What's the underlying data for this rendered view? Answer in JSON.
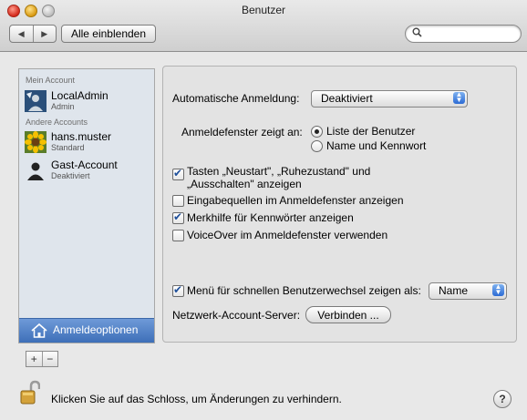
{
  "window": {
    "title": "Benutzer"
  },
  "toolbar": {
    "back": "◀",
    "forward": "▶",
    "show_all": "Alle einblenden",
    "search_icon": "search-icon"
  },
  "sidebar": {
    "my_account_header": "Mein Account",
    "other_accounts_header": "Andere Accounts",
    "accounts": [
      {
        "name": "LocalAdmin",
        "role": "Admin"
      },
      {
        "name": "hans.muster",
        "role": "Standard"
      },
      {
        "name": "Gast-Account",
        "role": "Deaktiviert"
      }
    ],
    "login_options": "Anmeldeoptionen",
    "add": "+",
    "remove": "−"
  },
  "panel": {
    "auto_login_label": "Automatische Anmeldung:",
    "auto_login_value": "Deaktiviert",
    "window_shows_label": "Anmeldefenster zeigt an:",
    "radio_list": "Liste der Benutzer",
    "radio_name": "Name und Kennwort",
    "check_restart_line1": "Tasten „Neustart\", „Ruhezustand\" und",
    "check_restart_line2": "„Ausschalten\" anzeigen",
    "check_input": "Eingabequellen im Anmeldefenster anzeigen",
    "check_hints": "Merkhilfe für Kennwörter anzeigen",
    "check_voiceover": "VoiceOver im Anmeldefenster verwenden",
    "check_fast_switch": "Menü für schnellen Benutzerwechsel zeigen als:",
    "fast_switch_value": "Name",
    "network_server_label": "Netzwerk-Account-Server:",
    "connect_button": "Verbinden ..."
  },
  "footer": {
    "lock_text": "Klicken Sie auf das Schloss, um Änderungen zu verhindern.",
    "help": "?"
  },
  "colors": {
    "accent": "#3d6fb8",
    "sidebar_bg": "#dfe5ec"
  }
}
